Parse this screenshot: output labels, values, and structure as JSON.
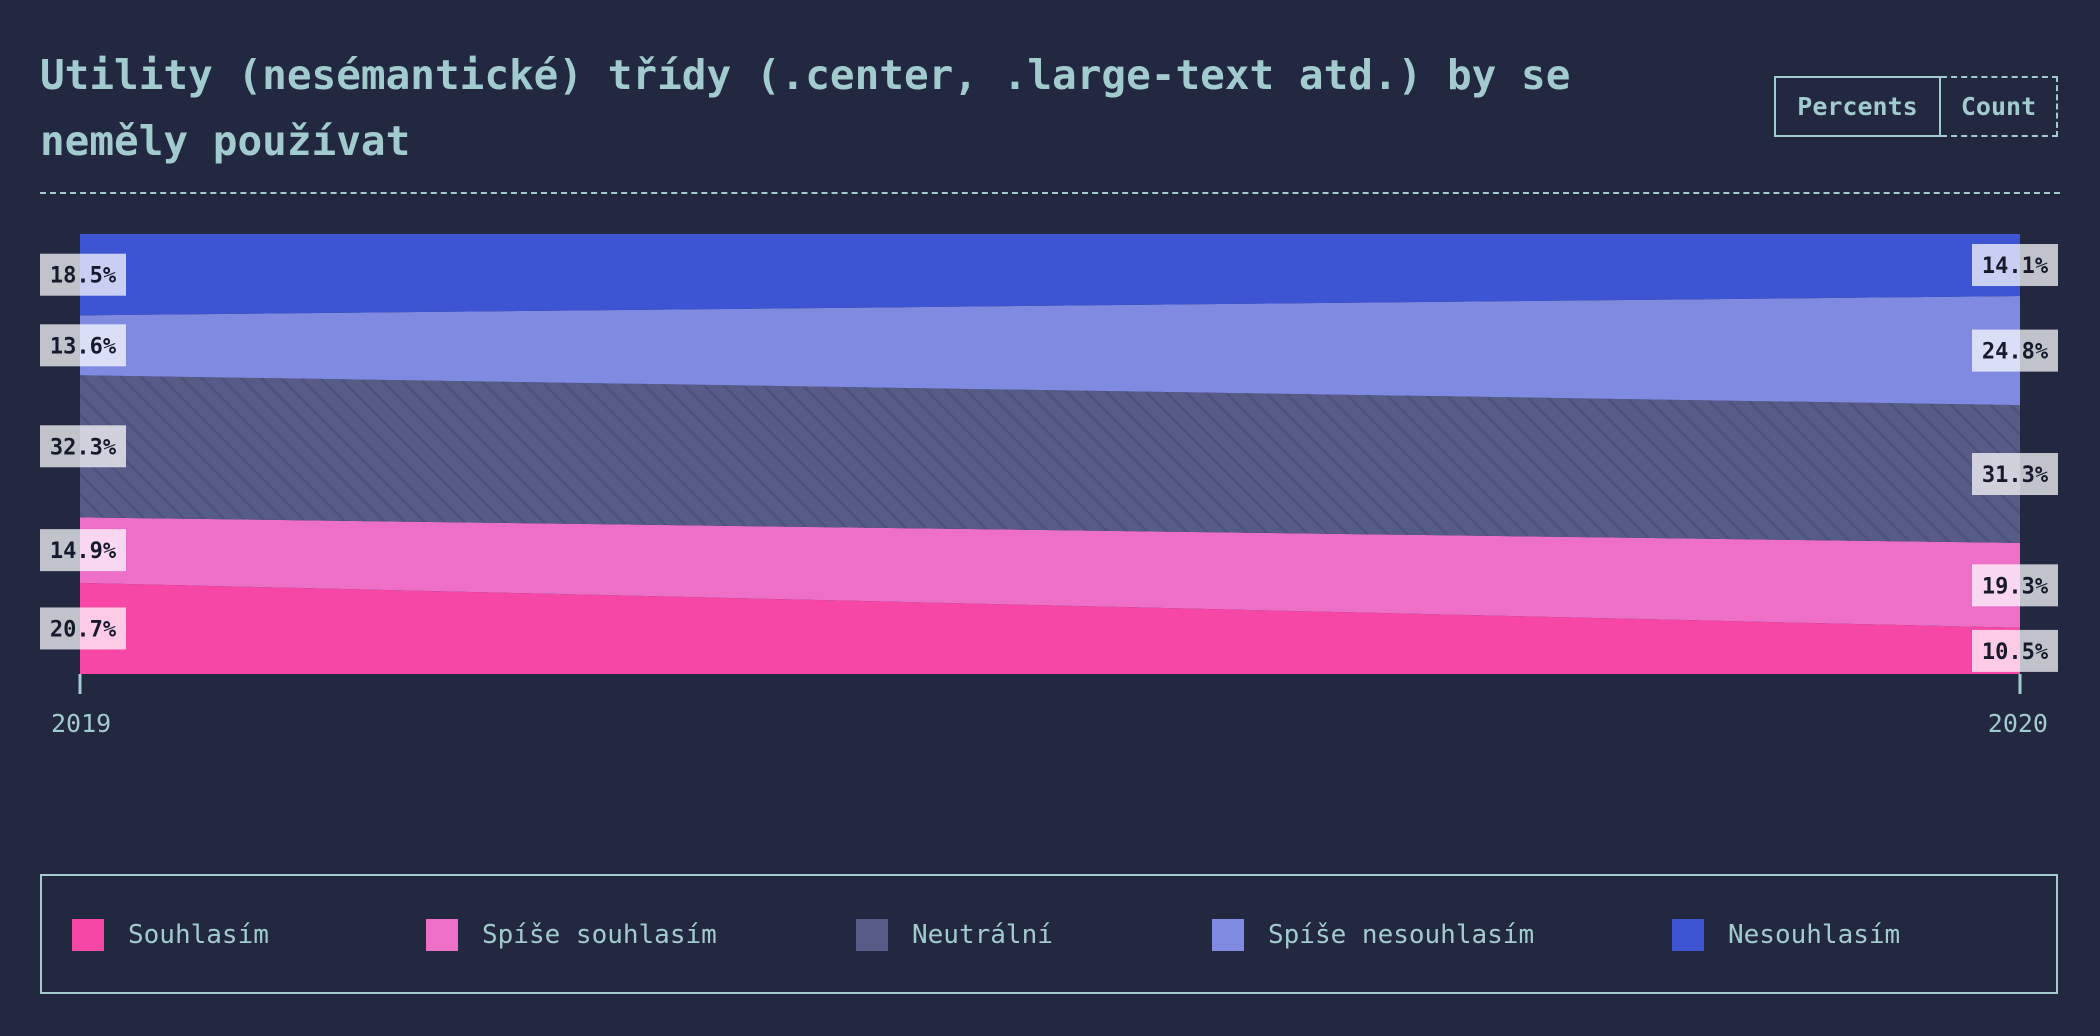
{
  "header": {
    "title": "Utility (nesémantické) třídy (.center, .large-text atd.) by se neměly používat",
    "toggle": {
      "percents_label": "Percents",
      "count_label": "Count",
      "selected": "Percents"
    }
  },
  "chart_data": {
    "type": "area",
    "stacked": true,
    "normalized": true,
    "x": [
      "2019",
      "2020"
    ],
    "ylim": [
      0,
      100
    ],
    "series": [
      {
        "name": "Souhlasím",
        "values": [
          20.7,
          10.5
        ],
        "labels": [
          "20.7%",
          "10.5%"
        ],
        "color": "#f646a6"
      },
      {
        "name": "Spíše souhlasím",
        "values": [
          14.9,
          19.3
        ],
        "labels": [
          "14.9%",
          "19.3%"
        ],
        "color": "#ed6fc8"
      },
      {
        "name": "Neutrální",
        "values": [
          32.3,
          31.3
        ],
        "labels": [
          "32.3%",
          "31.3%"
        ],
        "color": "#565b87",
        "pattern": "hatched"
      },
      {
        "name": "Spíše nesouhlasím",
        "values": [
          13.6,
          24.8
        ],
        "labels": [
          "13.6%",
          "24.8%"
        ],
        "color": "#7f8ae0"
      },
      {
        "name": "Nesouhlasím",
        "values": [
          18.5,
          14.1
        ],
        "labels": [
          "18.5%",
          "14.1%"
        ],
        "color": "#3d55d3"
      }
    ],
    "legend_position": "bottom"
  },
  "colors": {
    "background": "#232841",
    "foreground": "#a2cbcd",
    "label_box": "#ffffff",
    "label_text": "#161a2c"
  }
}
